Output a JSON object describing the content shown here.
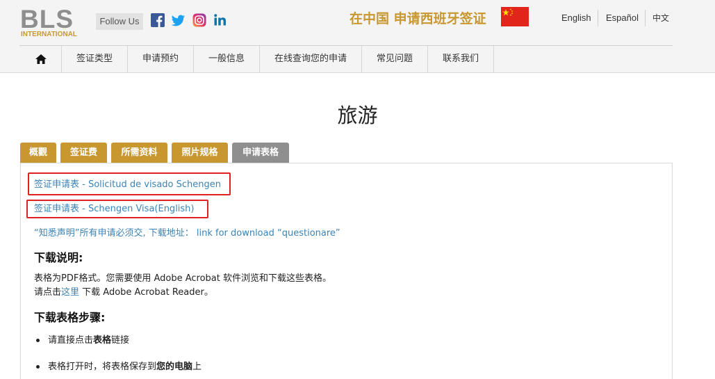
{
  "header": {
    "logo": {
      "main": "BLS",
      "sub": "INTERNATIONAL"
    },
    "follow_label": "Follow Us",
    "social_icons": [
      "facebook-icon",
      "twitter-icon",
      "instagram-icon",
      "linkedin-icon"
    ],
    "slogan": "在中国 申请西班牙签证",
    "flag_icon": "china-flag-icon",
    "languages": [
      "English",
      "Español",
      "中文"
    ]
  },
  "nav": {
    "home_icon": "home-icon",
    "items": [
      "签证类型",
      "申请预约",
      "一般信息",
      "在线查询您的申请",
      "常见问题",
      "联系我们"
    ]
  },
  "page": {
    "title": "旅游",
    "tabs": [
      "概觀",
      "签证费",
      "所需资料",
      "照片规格",
      "申请表格"
    ],
    "active_tab": "申请表格"
  },
  "content": {
    "links": [
      "签证申请表 - Solicitud de visado Schengen",
      "签证申请表 - Schengen Visa(English)",
      "“知悉声明”所有申请必须交, 下载地址： link for download “questionare”"
    ],
    "download_heading": "下载说明:",
    "download_line1": "表格为PDF格式。您需要使用 Adobe Acrobat 软件浏览和下载这些表格。",
    "download_line2_prefix": "请点击",
    "download_line2_link": "这里",
    "download_line2_suffix": " 下载 Adobe Acrobat Reader。",
    "steps_heading": "下载表格步骤:",
    "steps": [
      {
        "before": "请直接点击",
        "bold": "表格",
        "after": "链接"
      },
      {
        "before": "表格打开时，将表格保存到",
        "bold": "您的电脑",
        "after": "上"
      }
    ]
  },
  "colors": {
    "gold": "#c8972f",
    "tab_active": "#8f8f8f",
    "link": "#3b83b6",
    "highlight": "#e02020"
  }
}
